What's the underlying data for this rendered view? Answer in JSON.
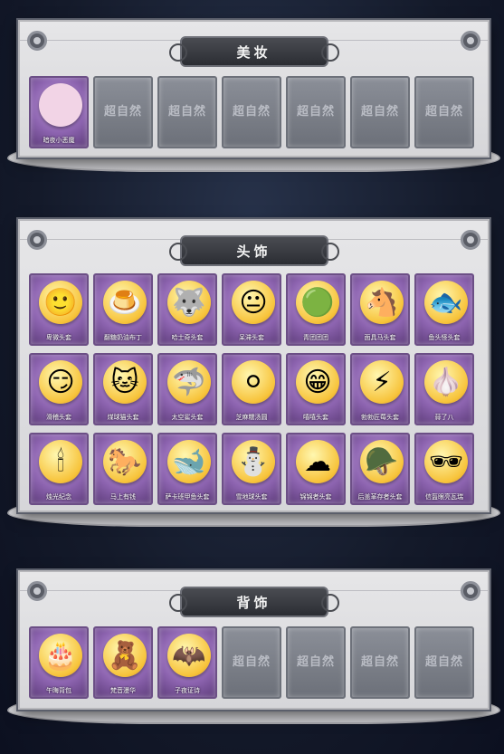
{
  "sections": [
    {
      "title": "美妆",
      "items": [
        {
          "label": "暗夜小恶魔",
          "icon": "devil-girl-icon",
          "bg": "#f2d4e6"
        },
        {
          "label": "",
          "empty": true,
          "watermark": "超自然"
        },
        {
          "label": "",
          "empty": true,
          "watermark": "超自然"
        },
        {
          "label": "",
          "empty": true,
          "watermark": "超自然"
        },
        {
          "label": "",
          "empty": true,
          "watermark": "超自然"
        },
        {
          "label": "",
          "empty": true,
          "watermark": "超自然"
        },
        {
          "label": "",
          "empty": true,
          "watermark": "超自然"
        }
      ]
    },
    {
      "title": "头饰",
      "items": [
        {
          "label": "卑微头套",
          "icon": "smiley-face-icon",
          "glyph": "🙂"
        },
        {
          "label": "翻糖奶油布丁",
          "icon": "pudding-icon",
          "glyph": "🍮"
        },
        {
          "label": "哈士奇头套",
          "icon": "husky-icon",
          "glyph": "🐺"
        },
        {
          "label": "呆滞头套",
          "icon": "dazed-face-icon",
          "glyph": "😐"
        },
        {
          "label": "青团团团",
          "icon": "green-ball-icon",
          "glyph": "🟢"
        },
        {
          "label": "面具马头套",
          "icon": "horse-head-icon",
          "glyph": "🐴"
        },
        {
          "label": "鱼头怪头套",
          "icon": "fish-head-icon",
          "glyph": "🐟"
        },
        {
          "label": "滑稽头套",
          "icon": "funny-face-icon",
          "glyph": "😏"
        },
        {
          "label": "煤球猫头套",
          "icon": "cat-head-icon",
          "glyph": "🐱"
        },
        {
          "label": "太空鲨头套",
          "icon": "shark-head-icon",
          "glyph": "🦈"
        },
        {
          "label": "芝麻糯汤圆",
          "icon": "dumpling-icon",
          "glyph": "⚪"
        },
        {
          "label": "嘻嘻头套",
          "icon": "grin-face-icon",
          "glyph": "😁"
        },
        {
          "label": "勃勃匠莓头套",
          "icon": "pikachu-icon",
          "glyph": "⚡"
        },
        {
          "label": "蒜了八",
          "icon": "garlic-icon",
          "glyph": "🧄"
        },
        {
          "label": "烛光纪念",
          "icon": "candle-icon",
          "glyph": "🕯"
        },
        {
          "label": "马上有钱",
          "icon": "horse-icon",
          "glyph": "🐎"
        },
        {
          "label": "萨卡班甲鱼头套",
          "icon": "fish-ball-icon",
          "glyph": "🐋"
        },
        {
          "label": "雪地球头套",
          "icon": "snowman-icon",
          "glyph": "⛄"
        },
        {
          "label": "锦锦者头套",
          "icon": "cloud-head-icon",
          "glyph": "☁"
        },
        {
          "label": "后盖革存者头套",
          "icon": "gas-mask-icon",
          "glyph": "🪖"
        },
        {
          "label": "信盔眼亮瓦瑞",
          "icon": "pixel-sunglasses-icon",
          "glyph": "🕶"
        }
      ]
    },
    {
      "title": "背饰",
      "items": [
        {
          "label": "午晦背包",
          "icon": "cake-backpack-icon",
          "glyph": "🎂"
        },
        {
          "label": "梵音漫华",
          "icon": "doll-icon",
          "glyph": "🧸"
        },
        {
          "label": "子夜证诗",
          "icon": "dark-wing-icon",
          "glyph": "🦇"
        },
        {
          "label": "",
          "empty": true,
          "watermark": "超自然"
        },
        {
          "label": "",
          "empty": true,
          "watermark": "超自然"
        },
        {
          "label": "",
          "empty": true,
          "watermark": "超自然"
        },
        {
          "label": "",
          "empty": true,
          "watermark": "超自然"
        }
      ]
    }
  ]
}
